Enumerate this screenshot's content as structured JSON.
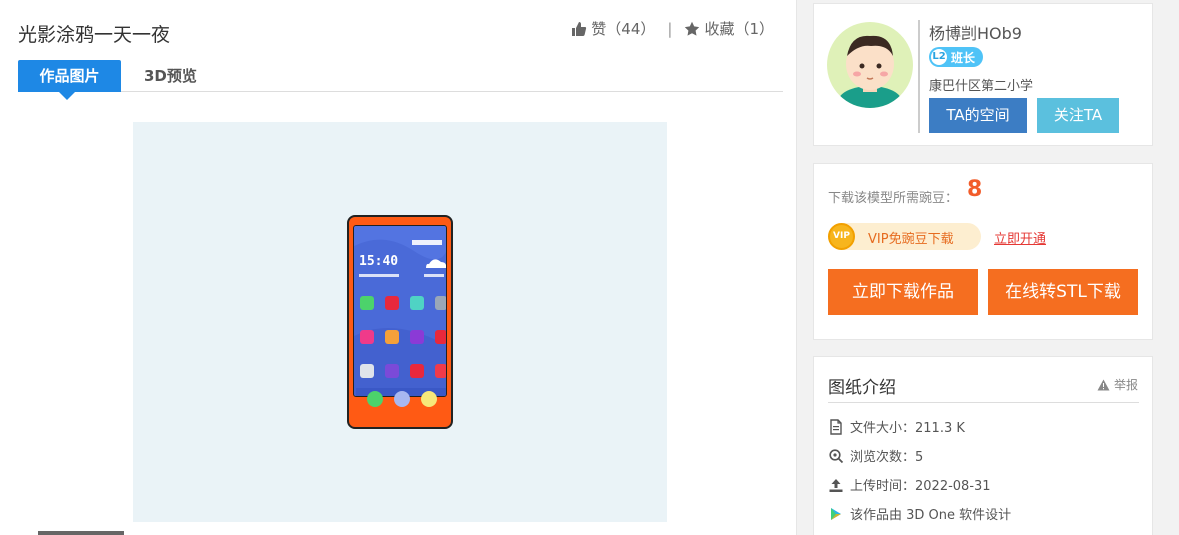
{
  "work": {
    "title": "光影涂鸦一天一夜",
    "like_label": "赞（44）",
    "separator": "|",
    "favorite_label": "收藏（1）",
    "tabs": [
      {
        "label": "作品图片",
        "active": true
      },
      {
        "label": "3D预览",
        "active": false
      }
    ],
    "phone_time": "15:40"
  },
  "author": {
    "name": "杨博剀HOb9",
    "level_badge": "L2",
    "role": "班长",
    "school": "康巴什区第二小学",
    "space_button": "TA的空间",
    "follow_button": "关注TA"
  },
  "download": {
    "label": "下载该模型所需豌豆：",
    "price": "8",
    "vip_coin": "VIP",
    "vip_text": "VIP免豌豆下载",
    "vip_open": "立即开通",
    "download_button": "立即下载作品",
    "stl_button": "在线转STL下载"
  },
  "info": {
    "title": "图纸介绍",
    "report": "举报",
    "rows": [
      {
        "icon": "file-icon",
        "text": "文件大小：211.3 K"
      },
      {
        "icon": "view-icon",
        "text": "浏览次数：5"
      },
      {
        "icon": "upload-icon",
        "text": "上传时间：2022-08-31"
      },
      {
        "icon": "software-icon",
        "text": "该作品由 3D One 软件设计"
      }
    ]
  },
  "colors": {
    "accent_blue": "#1e88e5",
    "download_orange": "#f56e20",
    "price_red": "#f25c2a",
    "phone_body": "#ff5a14",
    "phone_screen": "#4a6ad8"
  }
}
